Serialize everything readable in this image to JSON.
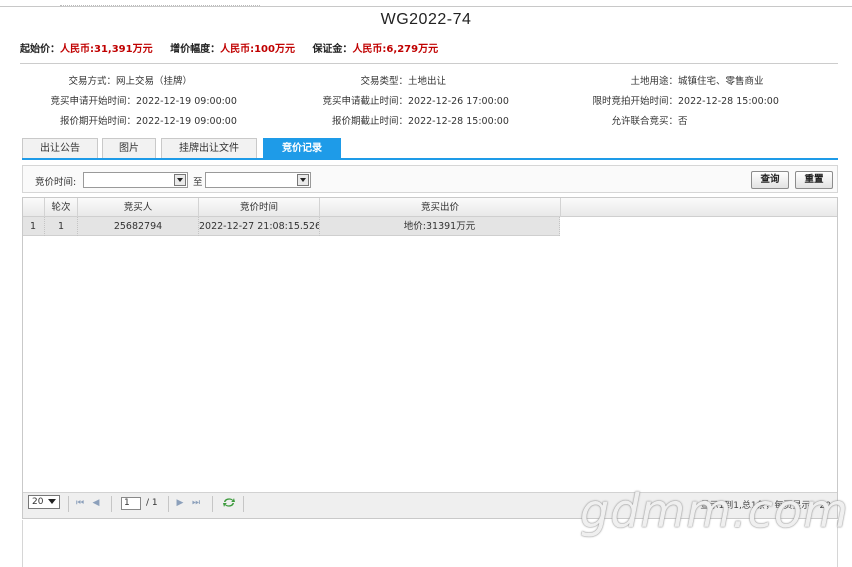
{
  "title": "WG2022-74",
  "price_bar": [
    {
      "label": "起始价：",
      "value": "人民币:31,391万元"
    },
    {
      "label": "增价幅度：",
      "value": "人民币:100万元"
    },
    {
      "label": "保证金：",
      "value": "人民币:6,279万元"
    }
  ],
  "info": {
    "trade_mode_label": "交易方式：",
    "trade_mode": "网上交易（挂牌）",
    "trade_type_label": "交易类型：",
    "trade_type": "土地出让",
    "land_use_label": "土地用途：",
    "land_use": "城镇住宅、零售商业",
    "apply_start_label": "竞买申请开始时间：",
    "apply_start": "2022-12-19 09:00:00",
    "apply_end_label": "竞买申请截止时间：",
    "apply_end": "2022-12-26 17:00:00",
    "timed_start_label": "限时竞拍开始时间：",
    "timed_start": "2022-12-28 15:00:00",
    "quote_start_label": "报价期开始时间：",
    "quote_start": "2022-12-19 09:00:00",
    "quote_end_label": "报价期截止时间：",
    "quote_end": "2022-12-28 15:00:00",
    "joint_label": "允许联合竞买：",
    "joint": "否"
  },
  "tabs": [
    "出让公告",
    "图片",
    "挂牌出让文件",
    "竞价记录"
  ],
  "active_tab": 3,
  "filter": {
    "label": "竞价时间:",
    "to_label": "至",
    "query_button": "查询",
    "reset_button": "重置"
  },
  "grid": {
    "headers": [
      "轮次",
      "竞买人",
      "竞价时间",
      "竞买出价"
    ],
    "rows": [
      {
        "index": "1",
        "round": "1",
        "bidder": "25682794",
        "time": "2022-12-27 21:08:15.526",
        "price": "地价:31391万元"
      }
    ]
  },
  "pager": {
    "page_size": "20",
    "page": "1",
    "total_pages": "/ 1",
    "info": "显示1到1,总1条，每页显示：20"
  },
  "watermark": "gdmm.com"
}
